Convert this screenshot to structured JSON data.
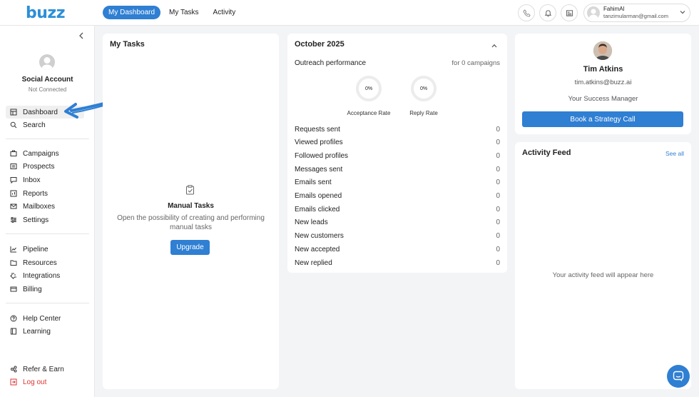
{
  "brand": {
    "logo_text": "buzz",
    "accent": "#2f7fd3"
  },
  "topnav": {
    "tabs": [
      "My Dashboard",
      "My Tasks",
      "Activity"
    ],
    "active": "My Dashboard"
  },
  "user": {
    "name": "FahimAl",
    "email": "tanzimularman@gmail.com"
  },
  "account": {
    "name": "Social Account",
    "status": "Not Connected"
  },
  "sidebar": {
    "group1": [
      {
        "label": "Dashboard",
        "icon": "dashboard-icon"
      },
      {
        "label": "Search",
        "icon": "search-icon"
      }
    ],
    "group2": [
      {
        "label": "Campaigns",
        "icon": "campaigns-icon"
      },
      {
        "label": "Prospects",
        "icon": "prospects-icon"
      },
      {
        "label": "Inbox",
        "icon": "inbox-icon"
      },
      {
        "label": "Reports",
        "icon": "reports-icon"
      },
      {
        "label": "Mailboxes",
        "icon": "mail-icon"
      },
      {
        "label": "Settings",
        "icon": "settings-icon"
      }
    ],
    "group3": [
      {
        "label": "Pipeline",
        "icon": "pipeline-icon"
      },
      {
        "label": "Resources",
        "icon": "folder-icon"
      },
      {
        "label": "Integrations",
        "icon": "integrations-icon"
      },
      {
        "label": "Billing",
        "icon": "billing-icon"
      }
    ],
    "group4": [
      {
        "label": "Help Center",
        "icon": "help-icon"
      },
      {
        "label": "Learning",
        "icon": "book-icon"
      }
    ],
    "group5": [
      {
        "label": "Refer & Earn",
        "icon": "refer-icon"
      },
      {
        "label": "Log out",
        "icon": "logout-icon"
      }
    ]
  },
  "tasks": {
    "title": "My Tasks",
    "empty_title": "Manual Tasks",
    "empty_desc": "Open the possibility of creating and performing manual tasks",
    "upgrade_label": "Upgrade"
  },
  "performance": {
    "month": "October 2025",
    "section": "Outreach performance",
    "campaigns_note": "for 0 campaigns",
    "acceptance": {
      "value": "0%",
      "label": "Acceptance Rate"
    },
    "reply": {
      "value": "0%",
      "label": "Reply Rate"
    },
    "metrics": [
      {
        "label": "Requests sent",
        "value": "0"
      },
      {
        "label": "Viewed profiles",
        "value": "0"
      },
      {
        "label": "Followed profiles",
        "value": "0"
      },
      {
        "label": "Messages sent",
        "value": "0"
      },
      {
        "label": "Emails sent",
        "value": "0"
      },
      {
        "label": "Emails opened",
        "value": "0"
      },
      {
        "label": "Emails clicked",
        "value": "0"
      },
      {
        "label": "New leads",
        "value": "0"
      },
      {
        "label": "New customers",
        "value": "0"
      },
      {
        "label": "New accepted",
        "value": "0"
      },
      {
        "label": "New replied",
        "value": "0"
      }
    ]
  },
  "manager": {
    "name": "Tim Atkins",
    "email": "tim.atkins@buzz.ai",
    "role": "Your Success Manager",
    "cta": "Book a Strategy Call"
  },
  "activity": {
    "title": "Activity Feed",
    "see_all": "See all",
    "empty": "Your activity feed will appear here"
  }
}
